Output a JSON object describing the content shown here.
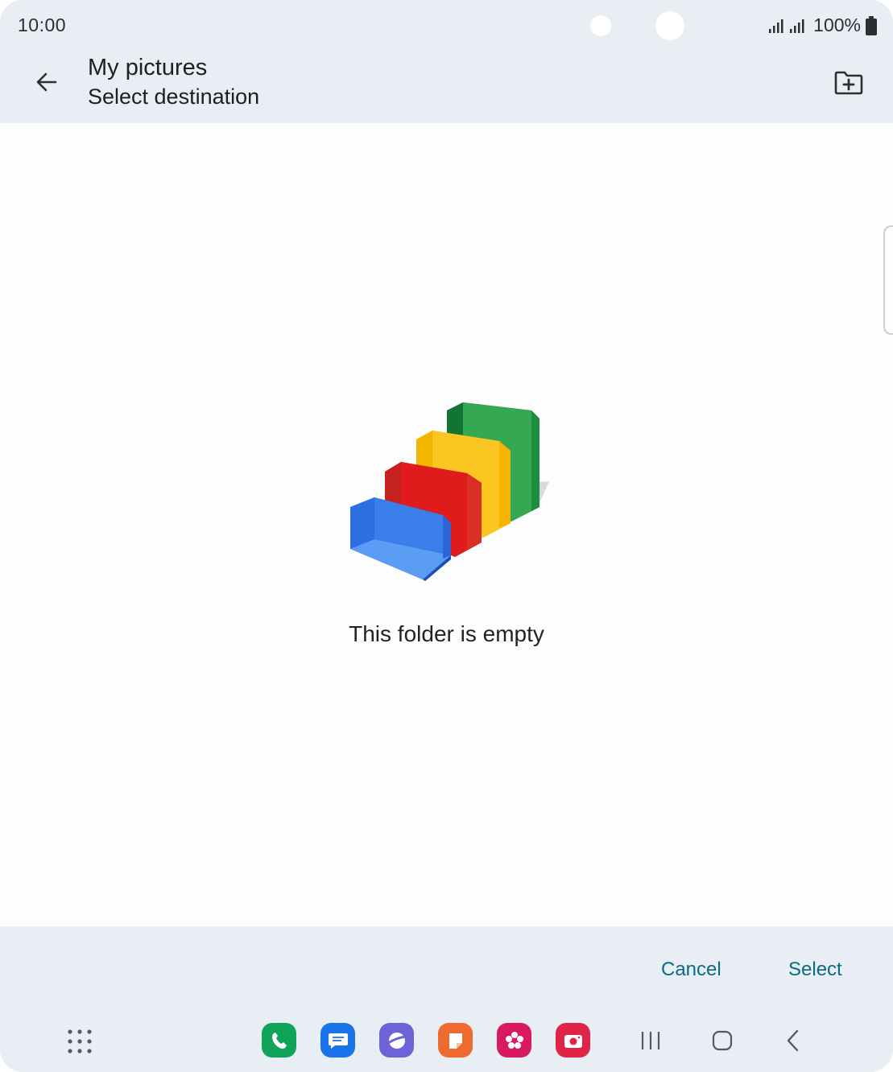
{
  "status_bar": {
    "time": "10:00",
    "battery": "100%",
    "icons": [
      "signal-icon",
      "signal-icon",
      "battery-icon"
    ]
  },
  "header": {
    "title": "My pictures",
    "subtitle": "Select destination",
    "back_icon": "arrow-back-icon",
    "new_folder_icon": "create-folder-icon"
  },
  "empty_state": {
    "message": "This folder is empty",
    "illustration": "stacked-folders-illustration",
    "colors": [
      "#4285f4",
      "#db4437",
      "#f4b400",
      "#0f9d58"
    ]
  },
  "actions": {
    "cancel_label": "Cancel",
    "select_label": "Select",
    "accent": "#0b6a86"
  },
  "nav": {
    "apps": [
      {
        "name": "phone-app",
        "color": "#10a35a"
      },
      {
        "name": "messages-app",
        "color": "#1a73e8"
      },
      {
        "name": "internet-app",
        "color": "#6c63d9"
      },
      {
        "name": "notes-app",
        "color": "#ef6a2f"
      },
      {
        "name": "gallery-app",
        "color": "#d81b60"
      },
      {
        "name": "camera-app",
        "color": "#e02447"
      }
    ],
    "keys": [
      "recents-icon",
      "home-icon",
      "back-nav-icon"
    ]
  }
}
